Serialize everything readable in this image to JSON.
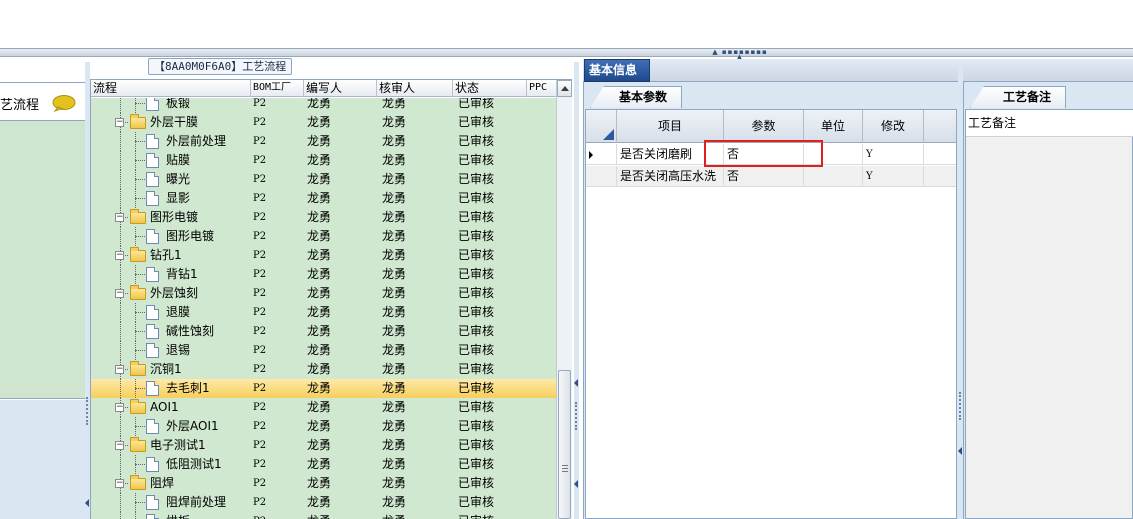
{
  "left_panel": {
    "label": "艺流程"
  },
  "process_panel": {
    "title": "【8AA0M0F6A0】工艺流程",
    "columns": [
      "流程",
      "BOM工厂",
      "编写人",
      "核审人",
      "状态",
      "PPC"
    ],
    "rows": [
      {
        "name": "板锻",
        "level": 2,
        "type": "item",
        "factory": "P2",
        "author": "龙勇",
        "reviewer": "龙勇",
        "status": "已审核"
      },
      {
        "name": "外层干膜",
        "level": 1,
        "type": "folder",
        "factory": "P2",
        "author": "龙勇",
        "reviewer": "龙勇",
        "status": "已审核"
      },
      {
        "name": "外层前处理",
        "level": 2,
        "type": "item",
        "factory": "P2",
        "author": "龙勇",
        "reviewer": "龙勇",
        "status": "已审核"
      },
      {
        "name": "贴膜",
        "level": 2,
        "type": "item",
        "factory": "P2",
        "author": "龙勇",
        "reviewer": "龙勇",
        "status": "已审核"
      },
      {
        "name": "曝光",
        "level": 2,
        "type": "item",
        "factory": "P2",
        "author": "龙勇",
        "reviewer": "龙勇",
        "status": "已审核"
      },
      {
        "name": "显影",
        "level": 2,
        "type": "item",
        "factory": "P2",
        "author": "龙勇",
        "reviewer": "龙勇",
        "status": "已审核"
      },
      {
        "name": "图形电镀",
        "level": 1,
        "type": "folder",
        "factory": "P2",
        "author": "龙勇",
        "reviewer": "龙勇",
        "status": "已审核"
      },
      {
        "name": "图形电镀",
        "level": 2,
        "type": "item",
        "factory": "P2",
        "author": "龙勇",
        "reviewer": "龙勇",
        "status": "已审核"
      },
      {
        "name": "钻孔1",
        "level": 1,
        "type": "folder",
        "factory": "P2",
        "author": "龙勇",
        "reviewer": "龙勇",
        "status": "已审核"
      },
      {
        "name": "背钻1",
        "level": 2,
        "type": "item",
        "factory": "P2",
        "author": "龙勇",
        "reviewer": "龙勇",
        "status": "已审核"
      },
      {
        "name": "外层蚀刻",
        "level": 1,
        "type": "folder",
        "factory": "P2",
        "author": "龙勇",
        "reviewer": "龙勇",
        "status": "已审核"
      },
      {
        "name": "退膜",
        "level": 2,
        "type": "item",
        "factory": "P2",
        "author": "龙勇",
        "reviewer": "龙勇",
        "status": "已审核"
      },
      {
        "name": "碱性蚀刻",
        "level": 2,
        "type": "item",
        "factory": "P2",
        "author": "龙勇",
        "reviewer": "龙勇",
        "status": "已审核"
      },
      {
        "name": "退锡",
        "level": 2,
        "type": "item",
        "factory": "P2",
        "author": "龙勇",
        "reviewer": "龙勇",
        "status": "已审核"
      },
      {
        "name": "沉铜1",
        "level": 1,
        "type": "folder",
        "factory": "P2",
        "author": "龙勇",
        "reviewer": "龙勇",
        "status": "已审核"
      },
      {
        "name": "去毛刺1",
        "level": 2,
        "type": "item",
        "factory": "P2",
        "author": "龙勇",
        "reviewer": "龙勇",
        "status": "已审核",
        "selected": true
      },
      {
        "name": "AOI1",
        "level": 1,
        "type": "folder",
        "factory": "P2",
        "author": "龙勇",
        "reviewer": "龙勇",
        "status": "已审核"
      },
      {
        "name": "外层AOI1",
        "level": 2,
        "type": "item",
        "factory": "P2",
        "author": "龙勇",
        "reviewer": "龙勇",
        "status": "已审核"
      },
      {
        "name": "电子测试1",
        "level": 1,
        "type": "folder",
        "factory": "P2",
        "author": "龙勇",
        "reviewer": "龙勇",
        "status": "已审核"
      },
      {
        "name": "低阻测试1",
        "level": 2,
        "type": "item",
        "factory": "P2",
        "author": "龙勇",
        "reviewer": "龙勇",
        "status": "已审核"
      },
      {
        "name": "阻焊",
        "level": 1,
        "type": "folder",
        "factory": "P2",
        "author": "龙勇",
        "reviewer": "龙勇",
        "status": "已审核"
      },
      {
        "name": "阻焊前处理",
        "level": 2,
        "type": "item",
        "factory": "P2",
        "author": "龙勇",
        "reviewer": "龙勇",
        "status": "已审核"
      },
      {
        "name": "烘板",
        "level": 2,
        "type": "item",
        "factory": "P2",
        "author": "龙勇",
        "reviewer": "龙勇",
        "status": "已审核"
      }
    ]
  },
  "info_panel": {
    "tab": "基本信息",
    "subtab": "基本参数",
    "columns": [
      "项目",
      "参数",
      "单位",
      "修改"
    ],
    "rows": [
      {
        "item": "是否关闭磨刷",
        "param": "否",
        "unit": "",
        "modify": "Y"
      },
      {
        "item": "是否关闭高压水洗",
        "param": "否",
        "unit": "",
        "modify": "Y"
      }
    ]
  },
  "remark_panel": {
    "tab": "工艺备注",
    "column": "工艺备注"
  },
  "colors": {
    "tree_bg": "#cfe8cf",
    "selected_row": "#f7cf5c",
    "active_tab": "#2a5aa0",
    "highlight_box": "#e01f1f"
  }
}
